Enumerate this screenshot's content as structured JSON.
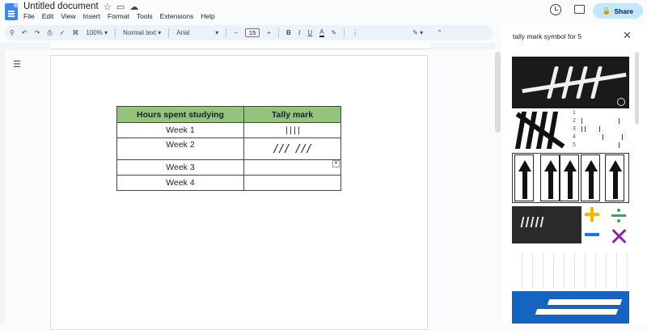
{
  "app": {
    "doc_title": "Untitled document",
    "menus": [
      "File",
      "Edit",
      "View",
      "Insert",
      "Format",
      "Tools",
      "Extensions",
      "Help"
    ],
    "share_label": "Share"
  },
  "toolbar": {
    "zoom": "100%",
    "style": "Normal text",
    "font": "Arial",
    "font_size": "15",
    "bold": "B",
    "italic": "I",
    "underline": "U",
    "text_color": "A"
  },
  "table": {
    "headers": [
      "Hours spent studying",
      "Tally mark"
    ],
    "rows": [
      {
        "week": "Week 1",
        "tally": "||||"
      },
      {
        "week": "Week 2",
        "tally": "/// ///"
      },
      {
        "week": "Week 3",
        "tally": ""
      },
      {
        "week": "Week 4",
        "tally": ""
      }
    ],
    "header_color": "#93c47d"
  },
  "side_panel": {
    "query": "tally mark symbol for 5"
  },
  "colors": {
    "accent": "#c2e7ff",
    "toolbar_bg": "#edf2fa"
  }
}
